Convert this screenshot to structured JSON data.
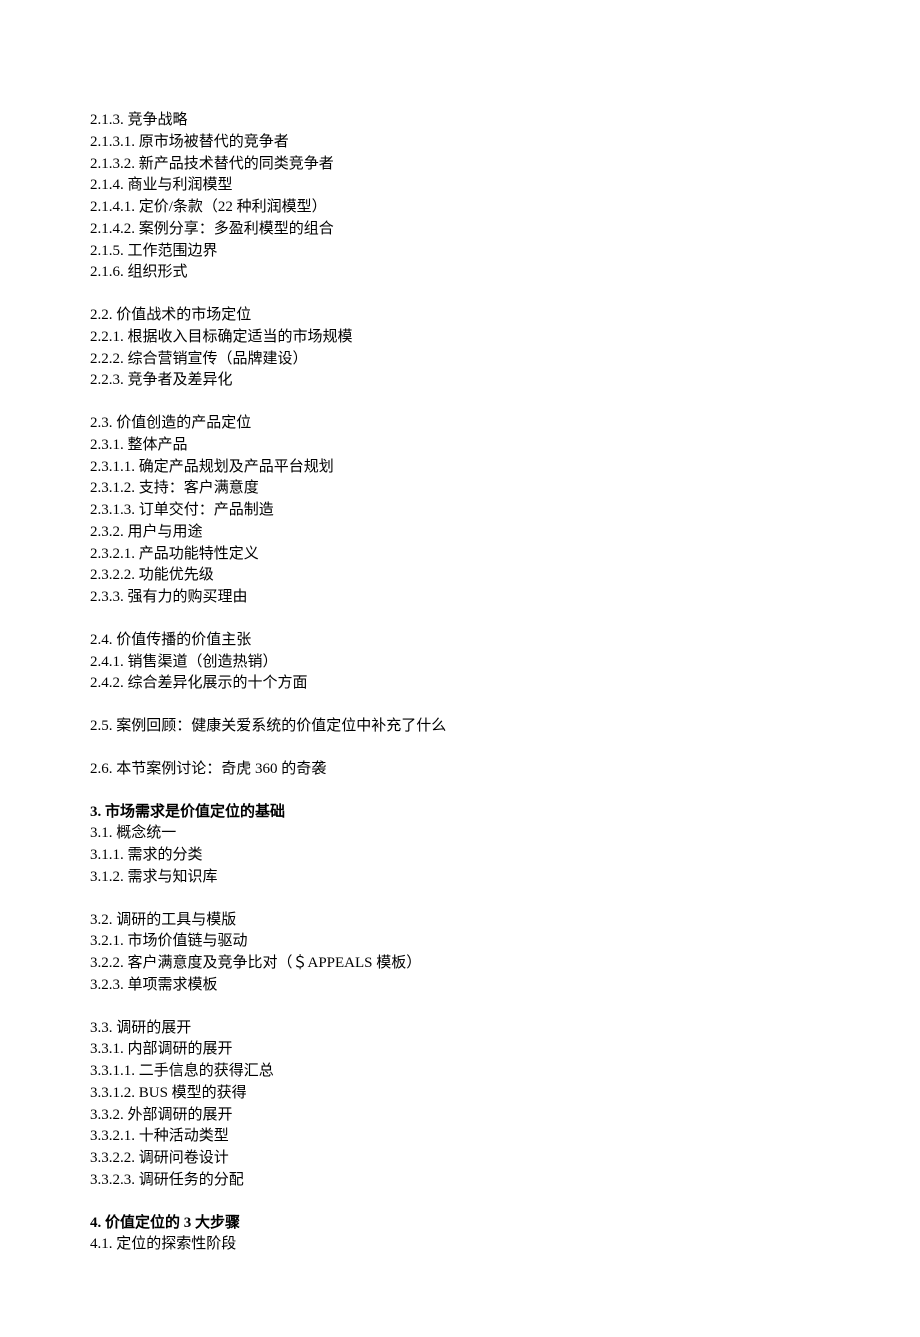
{
  "groups": [
    {
      "items": [
        {
          "num": "2.1.3.",
          "text": "竞争战略"
        },
        {
          "num": "2.1.3.1.",
          "text": "原市场被替代的竞争者"
        },
        {
          "num": "2.1.3.2.",
          "text": "新产品技术替代的同类竞争者"
        },
        {
          "num": "2.1.4.",
          "text": "商业与利润模型"
        },
        {
          "num": "2.1.4.1.",
          "text": "定价/条款（22 种利润模型）"
        },
        {
          "num": "2.1.4.2.",
          "text": "案例分享：多盈利模型的组合"
        },
        {
          "num": "2.1.5.",
          "text": "工作范围边界"
        },
        {
          "num": "2.1.6.",
          "text": "组织形式"
        }
      ]
    },
    {
      "items": [
        {
          "num": "2.2.",
          "text": "价值战术的市场定位"
        },
        {
          "num": "2.2.1.",
          "text": "根据收入目标确定适当的市场规模"
        },
        {
          "num": "2.2.2.",
          "text": "综合营销宣传（品牌建设）"
        },
        {
          "num": "2.2.3.",
          "text": "竞争者及差异化"
        }
      ]
    },
    {
      "items": [
        {
          "num": "2.3.",
          "text": "价值创造的产品定位"
        },
        {
          "num": "2.3.1.",
          "text": "整体产品"
        },
        {
          "num": "2.3.1.1.",
          "text": "确定产品规划及产品平台规划"
        },
        {
          "num": "2.3.1.2.",
          "text": "支持：客户满意度"
        },
        {
          "num": "2.3.1.3.",
          "text": "订单交付：产品制造"
        },
        {
          "num": "2.3.2.",
          "text": "用户与用途"
        },
        {
          "num": "2.3.2.1.",
          "text": "产品功能特性定义"
        },
        {
          "num": "2.3.2.2.",
          "text": "功能优先级"
        },
        {
          "num": "2.3.3.",
          "text": "强有力的购买理由"
        }
      ]
    },
    {
      "items": [
        {
          "num": "2.4.",
          "text": "价值传播的价值主张"
        },
        {
          "num": "2.4.1.",
          "text": "销售渠道（创造热销）"
        },
        {
          "num": "2.4.2.",
          "text": "综合差异化展示的十个方面"
        }
      ]
    },
    {
      "items": [
        {
          "num": "2.5.",
          "text": "案例回顾：健康关爱系统的价值定位中补充了什么"
        }
      ]
    },
    {
      "items": [
        {
          "num": "2.6.",
          "text": "本节案例讨论：奇虎 360 的奇袭"
        }
      ]
    },
    {
      "items": [
        {
          "num": "3.",
          "text": "市场需求是价值定位的基础",
          "bold": true
        },
        {
          "num": "3.1.",
          "text": "概念统一"
        },
        {
          "num": "3.1.1.",
          "text": "需求的分类"
        },
        {
          "num": "3.1.2.",
          "text": "需求与知识库"
        }
      ]
    },
    {
      "items": [
        {
          "num": "3.2.",
          "text": "调研的工具与模版"
        },
        {
          "num": "3.2.1.",
          "text": "市场价值链与驱动"
        },
        {
          "num": "3.2.2.",
          "text": "客户满意度及竞争比对（＄APPEALS 模板）"
        },
        {
          "num": "3.2.3.",
          "text": "单项需求模板"
        }
      ]
    },
    {
      "items": [
        {
          "num": "3.3.",
          "text": "调研的展开"
        },
        {
          "num": "3.3.1.",
          "text": "内部调研的展开"
        },
        {
          "num": "3.3.1.1.",
          "text": "二手信息的获得汇总"
        },
        {
          "num": "3.3.1.2.",
          "text": "BUS 模型的获得"
        },
        {
          "num": "3.3.2.",
          "text": "外部调研的展开"
        },
        {
          "num": "3.3.2.1.",
          "text": "十种活动类型"
        },
        {
          "num": "3.3.2.2.",
          "text": "调研问卷设计"
        },
        {
          "num": "3.3.2.3.",
          "text": "调研任务的分配"
        }
      ]
    },
    {
      "items": [
        {
          "num": "4.",
          "text": "价值定位的 3 大步骤",
          "bold": true
        },
        {
          "num": "4.1.",
          "text": "定位的探索性阶段"
        }
      ]
    }
  ]
}
